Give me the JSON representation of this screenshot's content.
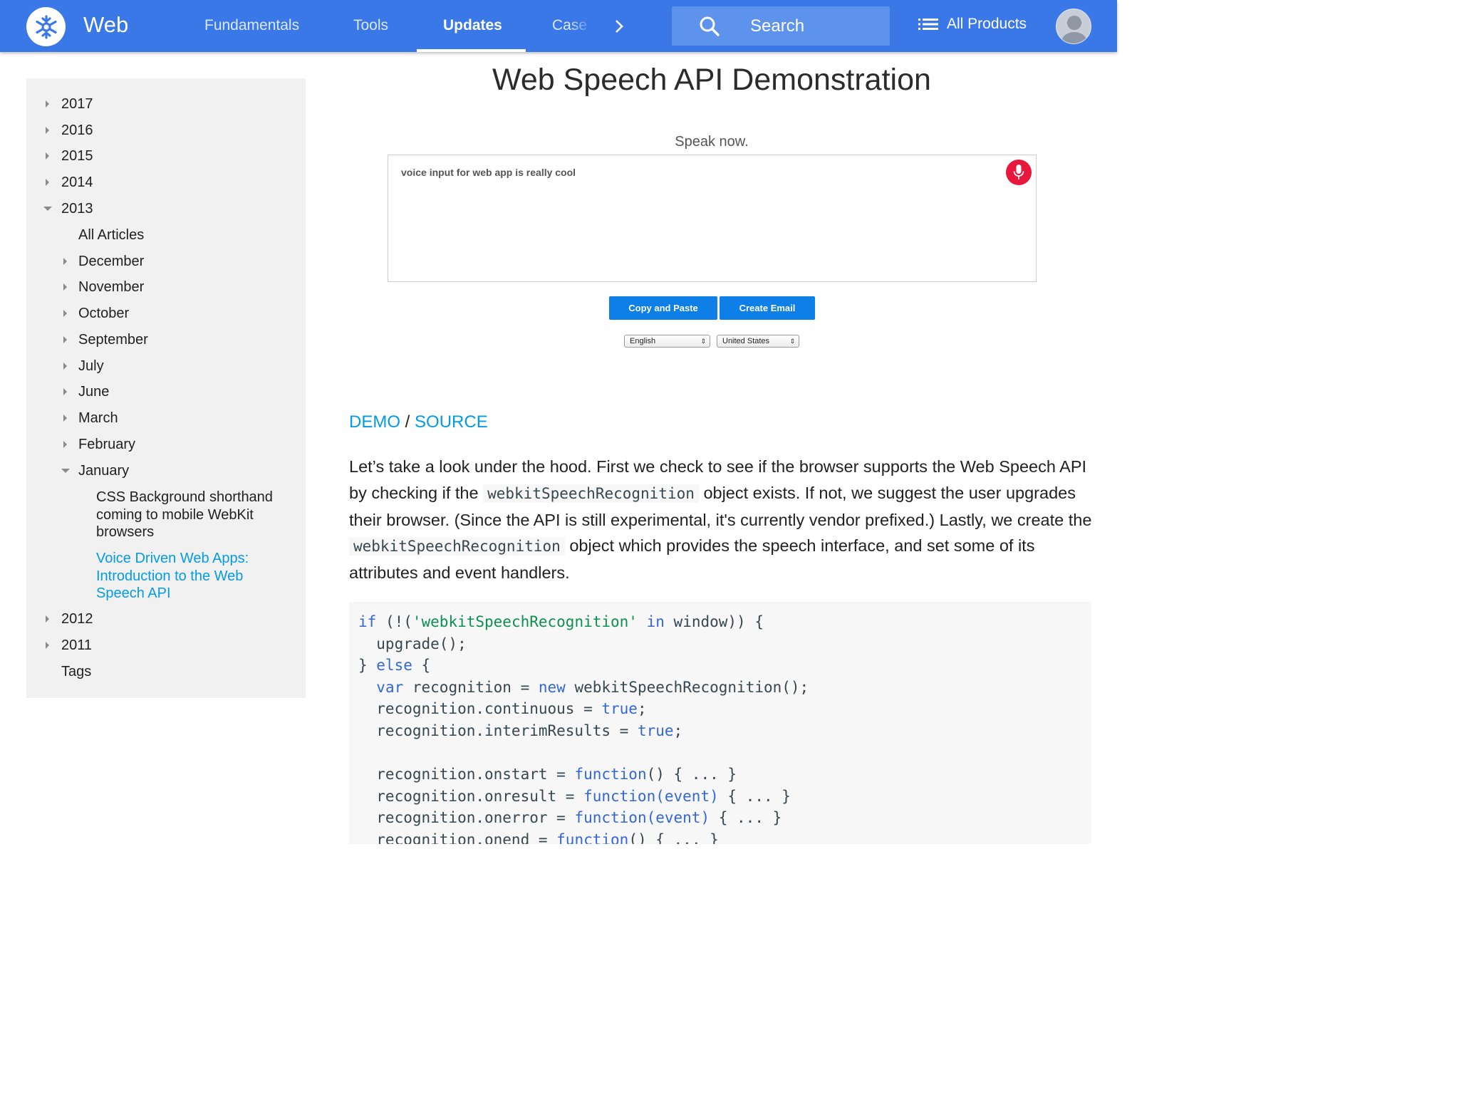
{
  "header": {
    "site_title": "Web",
    "tabs": [
      {
        "label": "Fundamentals"
      },
      {
        "label": "Tools"
      },
      {
        "label": "Updates"
      },
      {
        "label": "Case Studies"
      }
    ],
    "active_tab": "Updates",
    "search_placeholder": "Search",
    "all_products_label": "All Products",
    "accent_color": "#3b78e7"
  },
  "sidebar": {
    "years_top": [
      "2017",
      "2016",
      "2015",
      "2014"
    ],
    "open_year": "2013",
    "all_articles": "All Articles",
    "months": [
      "December",
      "November",
      "October",
      "September",
      "July",
      "June",
      "March",
      "February"
    ],
    "open_month": "January",
    "articles": [
      "CSS Background shorthand coming to mobile WebKit browsers",
      "Voice Driven Web Apps: Introduction to the Web Speech API"
    ],
    "years_bottom": [
      "2012",
      "2011"
    ],
    "tags": "Tags"
  },
  "demo": {
    "title": "Web Speech API Demonstration",
    "prompt": "Speak now.",
    "transcript": "voice input for web app is really cool",
    "copy_button": "Copy and Paste",
    "email_button": "Create Email",
    "language": "English",
    "dialect": "United States"
  },
  "article": {
    "demo_link": "DEMO",
    "separator": "/",
    "source_link": "SOURCE",
    "para_1": "Let’s take a look under the hood. First we check to see if the browser supports the Web Speech API by checking if the",
    "code_1": "webkitSpeechRecognition",
    "para_2": "object exists. If not, we suggest the user upgrades their browser. (Since the API is still experimental, it's currently vendor prefixed.) Lastly, we create the",
    "code_2": "webkitSpeechRecognition",
    "para_3": "object which provides the speech interface, and set some of its attributes and event handlers.",
    "code": {
      "l1_kw": "if",
      "l1_a": " (!(",
      "l1_str": "'webkitSpeechRecognition'",
      "l1_in": "in",
      "l1_b": " window)) {",
      "l2": "  upgrade();",
      "l3_a": "} ",
      "l3_kw": "else",
      "l3_b": " {",
      "l4_kw": "var",
      "l4_a": " recognition = ",
      "l4_new": "new",
      "l4_b": " webkitSpeechRecognition();",
      "l5_a": "  recognition.continuous = ",
      "l5_kw": "true",
      "l5_b": ";",
      "l6_a": "  recognition.interimResults = ",
      "l6_kw": "true",
      "l6_b": ";",
      "l8_a": "  recognition.onstart = ",
      "l8_kw": "function",
      "l8_b": "() { ... }",
      "l9_a": "  recognition.onresult = ",
      "l9_kw": "function",
      "l9_p": "(event)",
      "l9_b": " { ... }",
      "l10_a": "  recognition.onerror = ",
      "l10_kw": "function",
      "l10_p": "(event)",
      "l10_b": " { ... }",
      "l11_a": "  recognition.onend = ",
      "l11_kw": "function",
      "l11_b": "() { ... }"
    }
  }
}
